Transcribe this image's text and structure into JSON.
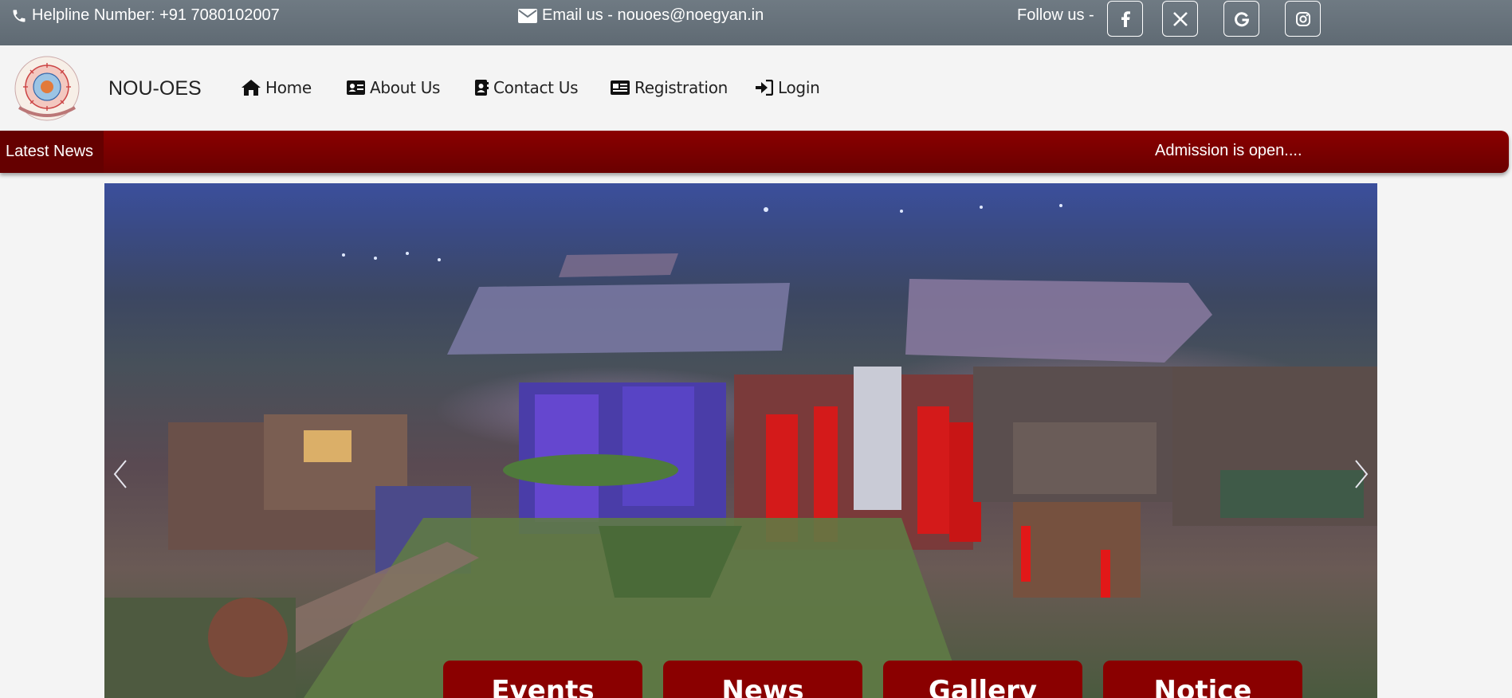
{
  "topbar": {
    "helpline": "Helpline Number: +91 7080102007",
    "email": "Email us - nouoes@noegyan.in",
    "follow": "Follow us -",
    "social_icons": [
      "facebook-icon",
      "x-icon",
      "google-icon",
      "instagram-icon"
    ]
  },
  "header": {
    "brand": "NOU-OES",
    "nav": [
      {
        "label": "Home",
        "icon": "home-icon"
      },
      {
        "label": "About Us",
        "icon": "id-card-icon"
      },
      {
        "label": "Contact Us",
        "icon": "contact-book-icon"
      },
      {
        "label": "Registration",
        "icon": "registration-icon"
      },
      {
        "label": "Login",
        "icon": "login-icon"
      }
    ]
  },
  "news": {
    "label": "Latest News",
    "ticker": "Admission is open...."
  },
  "tiles": [
    "Events",
    "News",
    "Gallery",
    "Notice"
  ],
  "colors": {
    "topbar": "#6b757e",
    "accent": "#7a0000",
    "background": "#f4f4f4"
  }
}
